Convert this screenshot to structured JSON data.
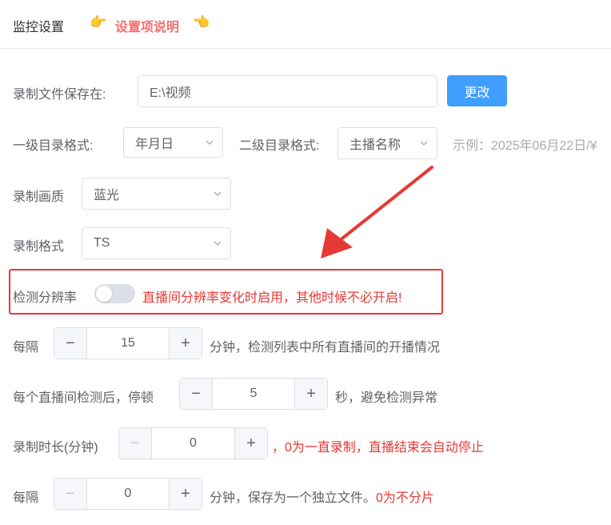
{
  "header": {
    "title": "监控设置",
    "help_link": "设置项说明",
    "left_hand_icon": "👉",
    "right_hand_icon": "👈"
  },
  "save_path": {
    "label": "录制文件保存在:",
    "value": "E:\\视频",
    "button": "更改"
  },
  "dir_format": {
    "level1_label": "一级目录格式:",
    "level1_value": "年月日",
    "level2_label": "二级目录格式:",
    "level2_value": "主播名称",
    "example": "示例：2025年06月22日/¥"
  },
  "quality": {
    "label": "录制画质",
    "value": "蓝光"
  },
  "format": {
    "label": "录制格式",
    "value": "TS"
  },
  "resolution_detect": {
    "label": "检测分辨率",
    "enabled": false,
    "note": "直播间分辨率变化时启用，其他时候不必开启!"
  },
  "interval": {
    "label": "每隔",
    "value": "15",
    "suffix": "分钟，检测列表中所有直播间的开播情况"
  },
  "pause": {
    "label": "每个直播间检测后，停顿",
    "value": "5",
    "suffix": "秒，避免检测异常"
  },
  "duration": {
    "label": "录制时长(分钟)",
    "value": "0",
    "suffix": "，0为一直录制，直播结束会自动停止"
  },
  "split": {
    "label": "每隔",
    "value": "0",
    "suffix": "分钟，保存为一个独立文件。",
    "suffix_red": "0为不分片"
  },
  "colors": {
    "primary": "#409eff",
    "annotation_red": "#e53935",
    "link_red": "#f56c6c"
  }
}
